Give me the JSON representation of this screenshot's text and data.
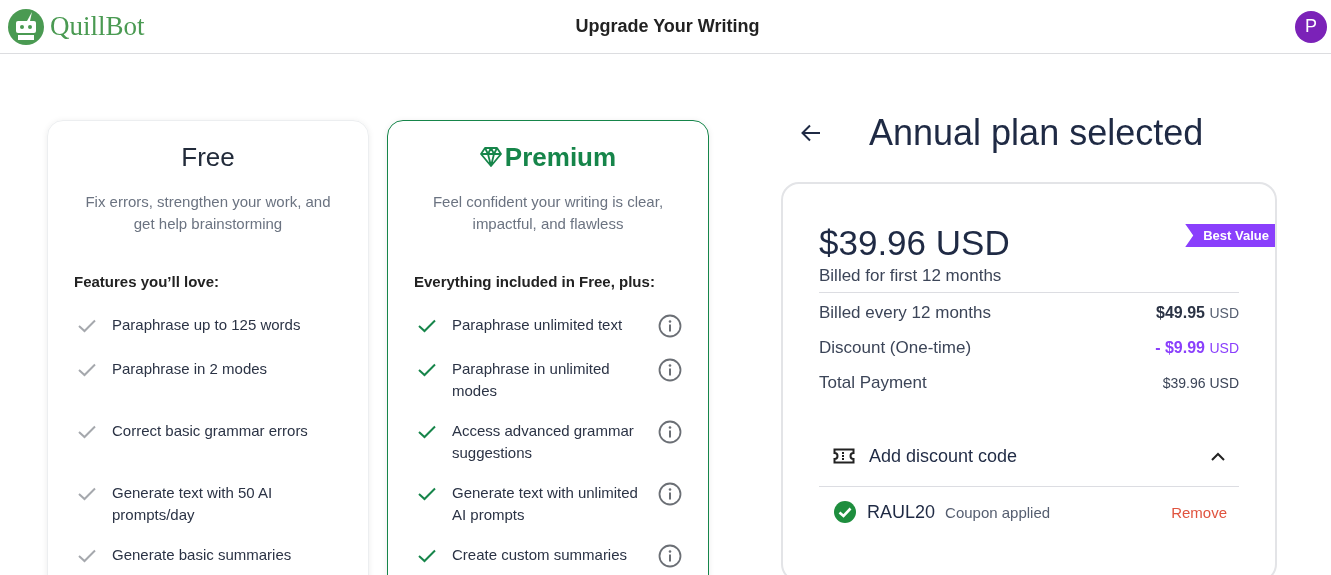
{
  "header": {
    "logo": "QuillBot",
    "title": "Upgrade Your Writing",
    "avatar": "P"
  },
  "plans": [
    {
      "kind": "free",
      "name": "Free",
      "description": "Fix errors, strengthen your work, and get help brainstorming",
      "features_title": "Features you’ll love:",
      "features": [
        {
          "text": "Paraphrase up to 125 words",
          "info": false
        },
        {
          "text": "Paraphrase in 2 modes",
          "info": false
        },
        {
          "text": "Correct basic grammar errors",
          "info": false
        },
        {
          "text": "Generate text with 50 AI prompts/day",
          "info": false
        },
        {
          "text": "Generate basic summaries",
          "info": false
        }
      ]
    },
    {
      "kind": "premium",
      "name": "Premium",
      "description": "Feel confident your writing is clear, impactful, and flawless",
      "features_title": "Everything included in Free, plus:",
      "features": [
        {
          "text": "Paraphrase unlimited text",
          "info": true
        },
        {
          "text": "Paraphrase in unlimited modes",
          "info": true
        },
        {
          "text": "Access advanced grammar suggestions",
          "info": true
        },
        {
          "text": "Generate text with unlimited AI prompts",
          "info": true
        },
        {
          "text": "Create custom summaries",
          "info": true
        }
      ]
    }
  ],
  "checkout": {
    "title": "Annual plan selected",
    "badge": "Best Value",
    "price": "$39.96 USD",
    "price_note": "Billed for first 12 months",
    "lines": [
      {
        "kind": "strong",
        "label": "Billed every 12 months",
        "amount": "$49.95",
        "currency": "USD"
      },
      {
        "kind": "discount",
        "label": "Discount (One-time)",
        "amount": "- $9.99",
        "currency": "USD"
      },
      {
        "kind": "plain",
        "label": "Total Payment",
        "amount": "$39.96 USD"
      }
    ],
    "discount": {
      "label": "Add discount code",
      "expanded": true,
      "code": "RAUL20",
      "status": "Coupon applied",
      "action": "Remove"
    }
  }
}
